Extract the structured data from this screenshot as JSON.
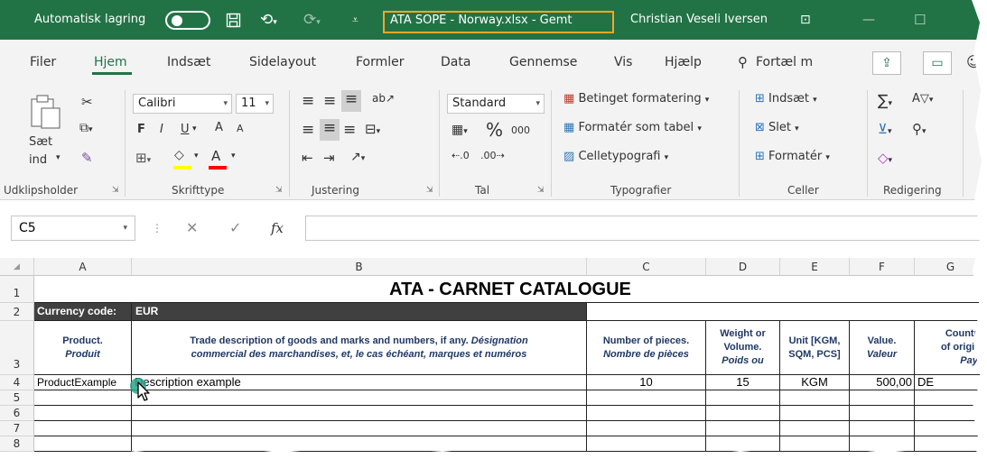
{
  "titlebar": {
    "autosave_label": "Automatisk lagring",
    "filename": "ATA SOPE - Norway.xlsx - Gemt",
    "username": "Christian Veseli Iversen"
  },
  "tabs": [
    {
      "label": "Filer"
    },
    {
      "label": "Hjem"
    },
    {
      "label": "Indsæt"
    },
    {
      "label": "Sidelayout"
    },
    {
      "label": "Formler"
    },
    {
      "label": "Data"
    },
    {
      "label": "Gennemse"
    },
    {
      "label": "Vis"
    },
    {
      "label": "Hjælp"
    },
    {
      "label": "Fortæl m"
    }
  ],
  "ribbon": {
    "clipboard": {
      "paste_label_1": "Sæt",
      "paste_label_2": "ind",
      "group": "Udklipsholder"
    },
    "font": {
      "name": "Calibri",
      "size": "11",
      "group": "Skrifttype",
      "bold": "F",
      "italic": "I",
      "underline": "U",
      "grow": "A",
      "shrink": "A",
      "fill_color": "#ffff00",
      "font_color": "#ff0000"
    },
    "alignment": {
      "group": "Justering"
    },
    "number": {
      "format": "Standard",
      "percent": "%",
      "thousands": "000",
      "group": "Tal"
    },
    "styles": {
      "conditional": "Betinget formatering",
      "as_table": "Formatér som tabel",
      "cell_styles": "Celletypografi",
      "group": "Typografier"
    },
    "cells": {
      "insert": "Indsæt",
      "delete": "Slet",
      "format": "Formatér",
      "group": "Celler"
    },
    "editing": {
      "group": "Redigering"
    }
  },
  "formula_bar": {
    "name_box": "C5",
    "fx": "fx",
    "value": ""
  },
  "grid": {
    "columns": [
      "A",
      "B",
      "C",
      "D",
      "E",
      "F",
      "G"
    ],
    "rows": [
      "1",
      "2",
      "3",
      "4",
      "5",
      "6",
      "7",
      "8"
    ],
    "title": "ATA - CARNET CATALOGUE",
    "currency_label": "Currency code:",
    "currency_value": "EUR",
    "headers": {
      "a_en": "Product.",
      "a_fr": "Produit",
      "b_en": "Trade description of goods and marks and numbers, if any.",
      "b_fr1": "Désignation",
      "b_fr2": "commercial des marchandises, et, le cas échéant, marques et numéros",
      "c_en": "Number of pieces.",
      "c_fr": "Nombre de pièces",
      "d_en1": "Weight or",
      "d_en2": "Volume.",
      "d_fr": "Poids ou",
      "e_en1": "Unit [KGM,",
      "e_en2": "SQM, PCS]",
      "f_en": "Value.",
      "f_fr": "Valeur",
      "g_en1": "Country",
      "g_en2": "of origin.",
      "g_fr": "Pays"
    },
    "row4": {
      "product": "ProductExample",
      "description": "Description example",
      "pieces": "10",
      "weight": "15",
      "unit": "KGM",
      "value": "500,00",
      "origin": "DE"
    }
  },
  "colors": {
    "excel_green": "#217346",
    "highlight_box": "#f5a623",
    "header_text": "#1f3864",
    "currency_bg": "#404040"
  }
}
